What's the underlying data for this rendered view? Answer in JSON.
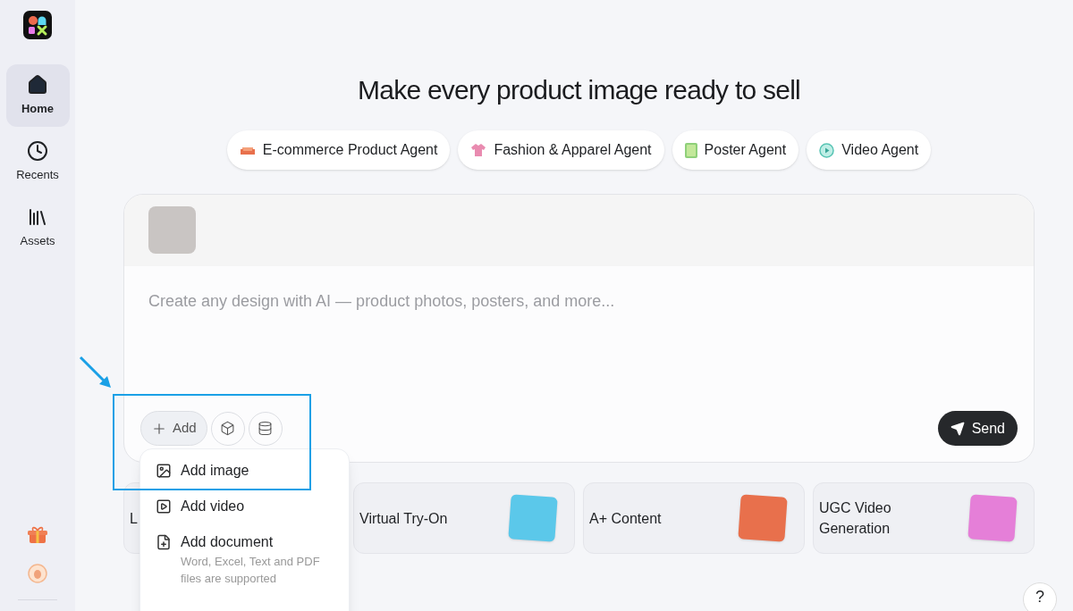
{
  "sidebar": {
    "items": [
      {
        "label": "Home",
        "kind": "home",
        "selected": true
      },
      {
        "label": "Recents",
        "kind": "clock",
        "selected": false
      },
      {
        "label": "Assets",
        "kind": "books",
        "selected": false
      }
    ]
  },
  "title": "Make every product image ready to sell",
  "agents": [
    {
      "label": "E-commerce Product Agent",
      "kind": "sofa"
    },
    {
      "label": "Fashion & Apparel Agent",
      "kind": "shirt"
    },
    {
      "label": "Poster Agent",
      "kind": "notebook"
    },
    {
      "label": "Video Agent",
      "kind": "play"
    }
  ],
  "composer": {
    "placeholder": "Create any design with AI — product photos, posters, and more...",
    "add_label": "Add",
    "send_label": "Send"
  },
  "add_menu": [
    {
      "label": "Add image",
      "kind": "image"
    },
    {
      "label": "Add video",
      "kind": "video"
    },
    {
      "label": "Add document",
      "kind": "document",
      "description": "Word, Excel, Text and PDF files are supported"
    }
  ],
  "cards": [
    {
      "title": "L"
    },
    {
      "title": "Virtual Try-On",
      "color": "#5bc8ea"
    },
    {
      "title": "A+ Content",
      "color": "#e8704c"
    },
    {
      "title": "UGC Video Generation",
      "color": "#e57fd8"
    }
  ],
  "help_label": "?"
}
